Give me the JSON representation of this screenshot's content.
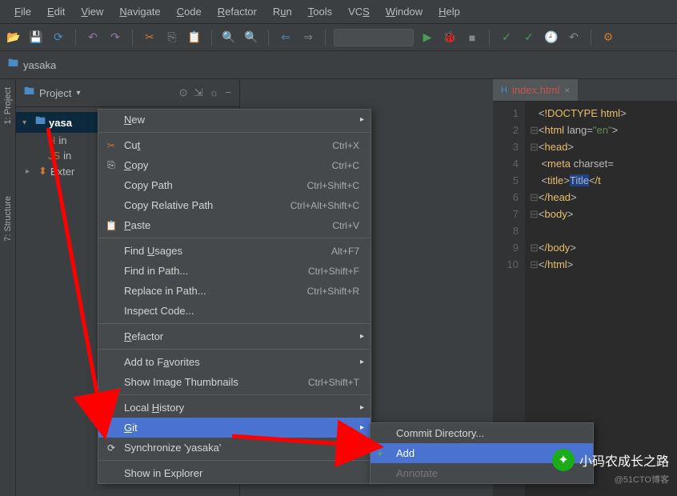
{
  "menubar": [
    "File",
    "Edit",
    "View",
    "Navigate",
    "Code",
    "Refactor",
    "Run",
    "Tools",
    "VCS",
    "Window",
    "Help"
  ],
  "breadcrumb": {
    "project": "yasaka"
  },
  "project_panel": {
    "title": "Project",
    "tree": {
      "root": "yasa",
      "child1": "in",
      "child2": "in",
      "external": "Exter"
    }
  },
  "side_tabs": {
    "project": "1: Project",
    "structure": "7: Structure"
  },
  "editor": {
    "tab": "index.html",
    "lines": [
      "1",
      "2",
      "3",
      "4",
      "5",
      "6",
      "7",
      "8",
      "9",
      "10"
    ],
    "code": {
      "doctype": "!DOCTYPE html",
      "html_open": "html",
      "lang_attr": "lang",
      "lang_val": "\"en\"",
      "head_open": "head",
      "meta": "meta",
      "charset_attr": "charset=",
      "title_tag": "title",
      "title_text": "Title",
      "title_close": "/t",
      "head_close": "/head",
      "body_open": "body",
      "body_close": "/body",
      "html_close": "/html"
    }
  },
  "context_menu": {
    "new": "New",
    "cut": "Cut",
    "cut_k": "Ctrl+X",
    "copy": "Copy",
    "copy_k": "Ctrl+C",
    "copy_path": "Copy Path",
    "copy_path_k": "Ctrl+Shift+C",
    "copy_rel": "Copy Relative Path",
    "copy_rel_k": "Ctrl+Alt+Shift+C",
    "paste": "Paste",
    "paste_k": "Ctrl+V",
    "find_usages": "Find Usages",
    "find_usages_k": "Alt+F7",
    "find_path": "Find in Path...",
    "find_path_k": "Ctrl+Shift+F",
    "replace_path": "Replace in Path...",
    "replace_path_k": "Ctrl+Shift+R",
    "inspect": "Inspect Code...",
    "refactor": "Refactor",
    "favorites": "Add to Favorites",
    "thumbnails": "Show Image Thumbnails",
    "thumbnails_k": "Ctrl+Shift+T",
    "local_history": "Local History",
    "git": "Git",
    "synchronize": "Synchronize 'yasaka'",
    "show_explorer": "Show in Explorer"
  },
  "submenu": {
    "commit_dir": "Commit Directory...",
    "add": "Add",
    "annotate": "Annotate"
  },
  "watermark": {
    "main": "小码农成长之路",
    "sub": "@51CTO博客"
  }
}
